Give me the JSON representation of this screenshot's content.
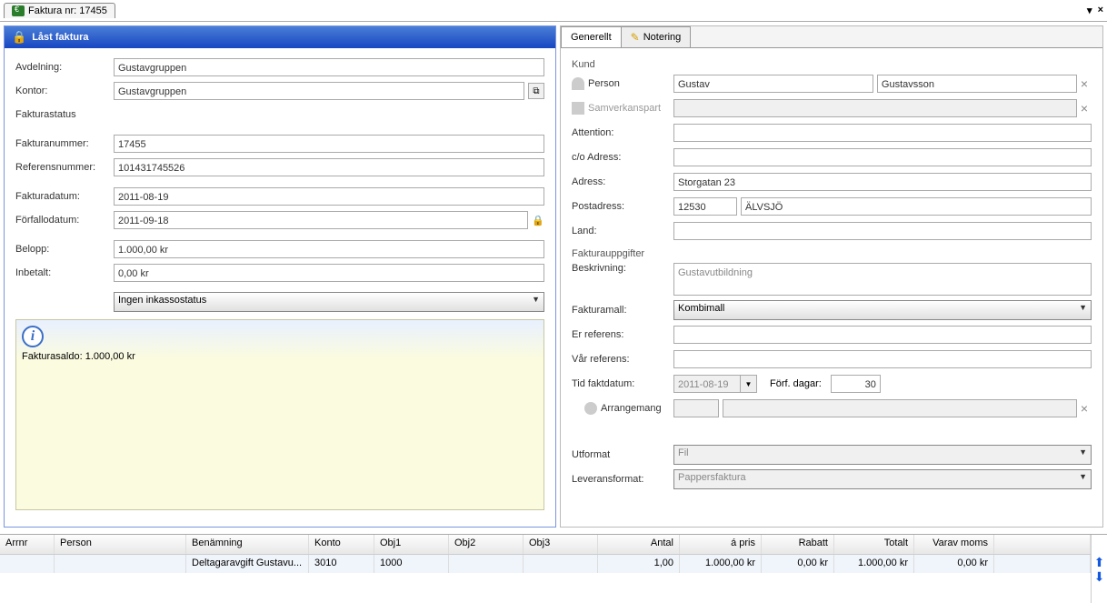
{
  "tab": {
    "title": "Faktura nr: 17455"
  },
  "panel_header": "Låst faktura",
  "left": {
    "avdelning_label": "Avdelning:",
    "avdelning": "Gustavgruppen",
    "kontor_label": "Kontor:",
    "kontor": "Gustavgruppen",
    "fakturastatus_label": "Fakturastatus",
    "fakturanummer_label": "Fakturanummer:",
    "fakturanummer": "17455",
    "referensnummer_label": "Referensnummer:",
    "referensnummer": "101431745526",
    "fakturadatum_label": "Fakturadatum:",
    "fakturadatum": "2011-08-19",
    "forfallodatum_label": "Förfallodatum:",
    "forfallodatum": "2011-09-18",
    "belopp_label": "Belopp:",
    "belopp": "1.000,00 kr",
    "inbetalt_label": "Inbetalt:",
    "inbetalt": "0,00 kr",
    "inkasso": "Ingen inkassostatus",
    "saldo": "Fakturasaldo: 1.000,00 kr"
  },
  "tabs": {
    "generellt": "Generellt",
    "notering": "Notering"
  },
  "right": {
    "kund": "Kund",
    "person_label": "Person",
    "person_first": "Gustav",
    "person_last": "Gustavsson",
    "samverkanspart_label": "Samverkanspart",
    "attention_label": "Attention:",
    "co_label": "c/o Adress:",
    "adress_label": "Adress:",
    "adress": "Storgatan 23",
    "postadress_label": "Postadress:",
    "post_nr": "12530",
    "post_ort": "ÄLVSJÖ",
    "land_label": "Land:",
    "fakturauppgifter": "Fakturauppgifter",
    "beskrivning_label": "Beskrivning:",
    "beskrivning": "Gustavutbildning",
    "fakturamall_label": "Fakturamall:",
    "fakturamall": "Kombimall",
    "er_referens_label": "Er referens:",
    "var_referens_label": "Vår referens:",
    "tid_faktdatum_label": "Tid faktdatum:",
    "tid_faktdatum": "2011-08-19",
    "forf_dagar_label": "Förf. dagar:",
    "forf_dagar": "30",
    "arrangemang_label": "Arrangemang",
    "utformat_label": "Utformat",
    "utformat": "Fil",
    "leveransformat_label": "Leveransformat:",
    "leveransformat": "Pappersfaktura"
  },
  "grid": {
    "headers": {
      "arrnr": "Arrnr",
      "person": "Person",
      "benamning": "Benämning",
      "konto": "Konto",
      "obj1": "Obj1",
      "obj2": "Obj2",
      "obj3": "Obj3",
      "antal": "Antal",
      "apris": "á pris",
      "rabatt": "Rabatt",
      "totalt": "Totalt",
      "moms": "Varav moms"
    },
    "row": {
      "arrnr": "",
      "person": "",
      "benamning": "Deltagaravgift Gustavu...",
      "konto": "3010",
      "obj1": "1000",
      "obj2": "",
      "obj3": "",
      "antal": "1,00",
      "apris": "1.000,00 kr",
      "rabatt": "0,00 kr",
      "totalt": "1.000,00 kr",
      "moms": "0,00 kr"
    }
  }
}
